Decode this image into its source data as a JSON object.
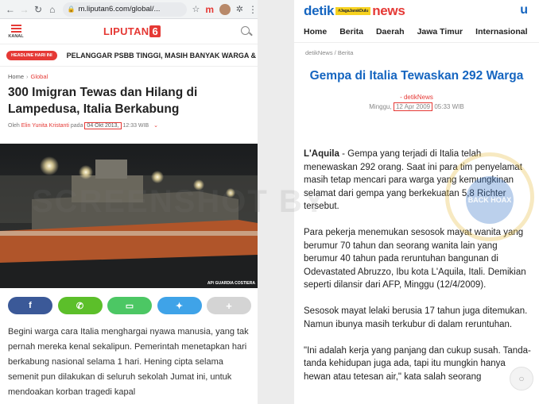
{
  "left": {
    "browser": {
      "url": "m.liputan6.com/global/...",
      "back_icon": "arrow-left-icon",
      "forward_icon": "arrow-right-icon"
    },
    "header": {
      "menu_label": "KANAL",
      "logo_text": "LIPUTAN",
      "logo_number": "6"
    },
    "ticker": {
      "badge": "HEADLINE HARI INI",
      "text": "PELANGGAR PSBB TINGGI, MASIH BANYAK WARGA &"
    },
    "breadcrumb": {
      "home": "Home",
      "separator": "›",
      "category": "Global"
    },
    "article": {
      "title": "300 Imigran Tewas dan Hilang di Lampedusa, Italia Berkabung",
      "byline_prefix": "Oleh",
      "author": "Elin Yunita Kristanti",
      "byline_mid": "pada",
      "date": "04 Okt 2013,",
      "time": "12:33 WIB",
      "photo_credit": "AP/ GUARDIA COSTIERA",
      "body": "Begini warga cara Italia menghargai nyawa manusia, yang tak pernah mereka kenal sekalipun. Pemerintah menetapkan hari berkabung nasional selama  1 hari. Hening cipta selama semenit pun dilakukan di seluruh sekolah Jumat ini, untuk mendoakan korban tragedi kapal"
    },
    "share_buttons": [
      {
        "icon": "facebook-icon",
        "glyph": "f"
      },
      {
        "icon": "whatsapp-icon",
        "glyph": "✆"
      },
      {
        "icon": "line-icon",
        "glyph": "▭"
      },
      {
        "icon": "twitter-icon",
        "glyph": "✦"
      },
      {
        "icon": "plus-icon",
        "glyph": "+"
      }
    ]
  },
  "right": {
    "logo": {
      "brand": "detik",
      "hashtag": "#JagaJarakDulu",
      "suffix": "news"
    },
    "nav": [
      "Home",
      "Berita",
      "Daerah",
      "Jawa Timur",
      "Internasional"
    ],
    "breadcrumb": "detikNews / Berita",
    "article": {
      "title": "Gempa di Italia Tewaskan 292 Warga",
      "source": "- detikNews",
      "day": "Minggu,",
      "date": "12 Apr 2009",
      "time": "05:33 WIB",
      "p1_lead": "L'Aquila",
      "p1": " - Gempa yang terjadi di Italia telah menewaskan 292 orang. Saat ini para tim penyelamat masih tetap mencari para warga yang kemungkinan selamat dari gempa yang berkekuatan 5,8 Richter tersebut.",
      "p2": "Para pekerja menemukan sesosok mayat wanita yang berumur 70 tahun dan seorang wanita lain yang berumur 40 tahun pada reruntuhan bangunan di Odevastated Abruzzo, Ibu kota L'Aquila, Itali. Demikian seperti dilansir dari AFP, Minggu (12/4/2009).",
      "p3": "Sesosok mayat lelaki berusia 17 tahun juga ditemukan. Namun ibunya  masih terkubur di dalam reruntuhan.",
      "p4": "\"Ini adalah kerja yang panjang dan cukup susah. Tanda-tanda kehidupan juga ada, tapi itu mungkin hanya hewan atau tetesan air,\" kata salah seorang"
    }
  },
  "watermark": {
    "text": "SCREENSHOT BY",
    "seal_text": "BACK HOAX"
  },
  "colors": {
    "liputan_red": "#e53935",
    "detik_blue": "#1565c0"
  }
}
